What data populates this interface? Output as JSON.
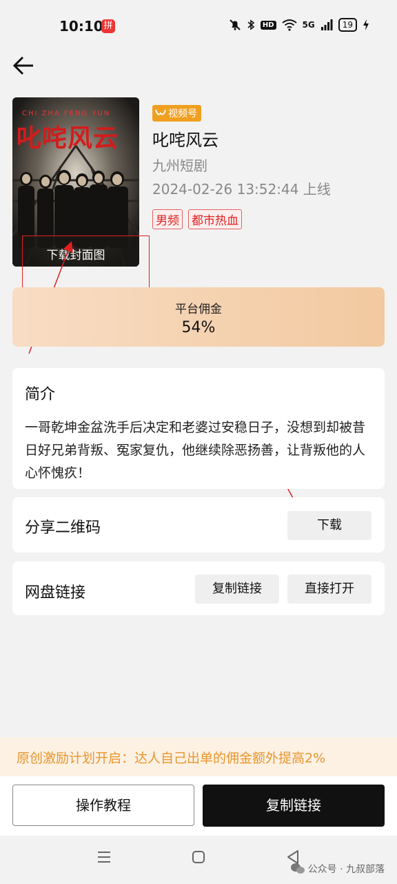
{
  "status": {
    "time": "10:10",
    "app_badge": "拼",
    "hd": "HD",
    "sig": "5G",
    "battery": "19"
  },
  "cover": {
    "title": "叱咤风云",
    "subtitle": "CHI ZHA FENG YUN",
    "download_label": "下载封面图"
  },
  "drama": {
    "channel_tag": "视频号",
    "title": "叱咤风云",
    "producer": "九州短剧",
    "online_time": "2024-02-26 13:52:44 上线",
    "tags": [
      "男频",
      "都市热血"
    ]
  },
  "commission": {
    "label": "平台佣金",
    "value": "54%"
  },
  "intro": {
    "title": "简介",
    "text": "一哥乾坤金盆洗手后决定和老婆过安稳日子，没想到却被昔日好兄弟背叛、冤家复仇，他继续除恶扬善，让背叛他的人心怀愧疚！"
  },
  "qrcode": {
    "label": "分享二维码",
    "download": "下载"
  },
  "netdisk": {
    "label": "网盘链接",
    "copy": "复制链接",
    "open": "直接打开"
  },
  "promo": {
    "text": "原创激励计划开启：达人自己出单的佣金额外提高2%"
  },
  "bottom": {
    "tutorial": "操作教程",
    "copy_link": "复制链接"
  },
  "watermark": {
    "text": "公众号 · 九叔部落"
  },
  "colors": {
    "accent_orange": "#e8962e",
    "annotation_red": "#e02020",
    "primary_dark": "#111111"
  }
}
